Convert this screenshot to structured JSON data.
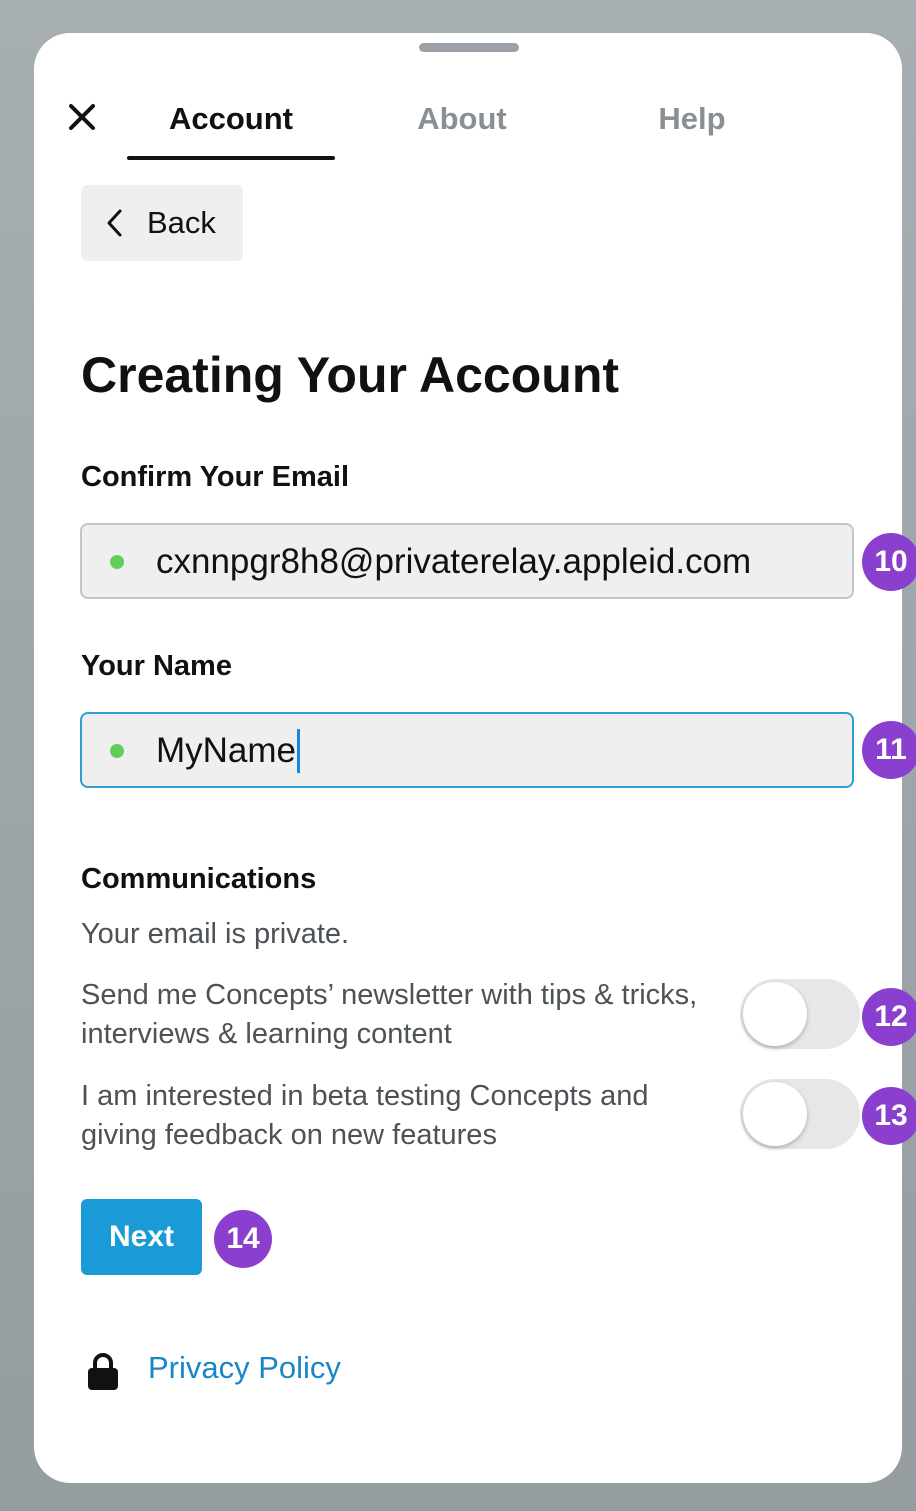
{
  "tabs": [
    {
      "label": "Account",
      "active": true
    },
    {
      "label": "About",
      "active": false
    },
    {
      "label": "Help",
      "active": false
    }
  ],
  "back_button": {
    "label": "Back",
    "icon": "chevron-left-icon"
  },
  "close_icon": "close-icon",
  "page_title": "Creating Your Account",
  "email_section": {
    "label": "Confirm Your Email",
    "value": "cxnnpgr8h8@privaterelay.appleid.com",
    "status_color": "#5fcf5a"
  },
  "name_section": {
    "label": "Your Name",
    "value": "MyName",
    "focused": true,
    "status_color": "#5fcf5a"
  },
  "communications": {
    "label": "Communications",
    "note": "Your email is private.",
    "options": [
      {
        "text": "Send me Concepts’ newsletter with tips & tricks, interviews & learning content",
        "enabled": false
      },
      {
        "text": "I am interested in beta testing Concepts and giving feedback on new features",
        "enabled": false
      }
    ]
  },
  "next_button": {
    "label": "Next",
    "color": "#1a9ad6"
  },
  "privacy": {
    "label": "Privacy Policy",
    "icon": "lock-icon",
    "color": "#1a86c8"
  },
  "annotation_badges": [
    "10",
    "11",
    "12",
    "13",
    "14"
  ],
  "colors": {
    "badge": "#8a3fcf",
    "focus_border": "#2d9fd0",
    "backdrop": "#9aa2a6"
  }
}
